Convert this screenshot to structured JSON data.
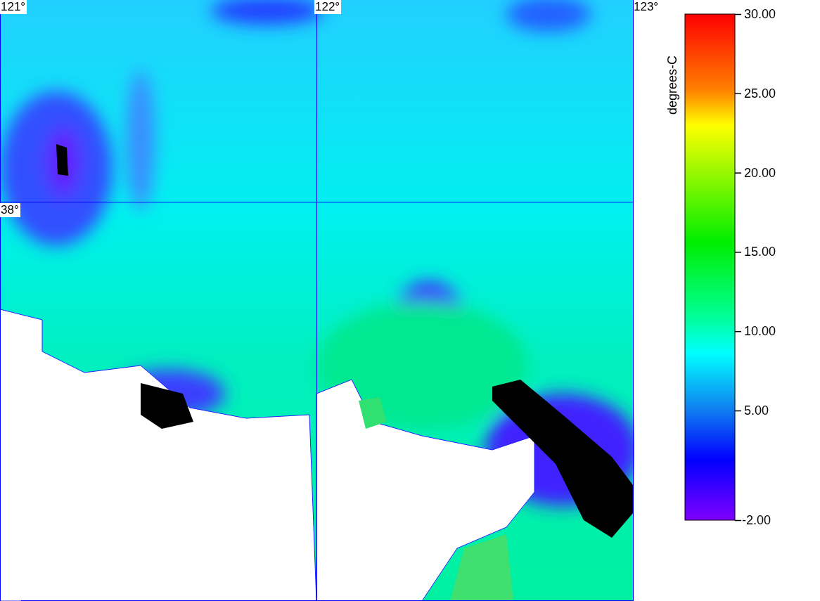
{
  "map": {
    "longitude_labels": [
      "121°",
      "122°",
      "123°"
    ],
    "latitude_labels": [
      "38°"
    ]
  },
  "colorbar": {
    "unit": "degrees-C",
    "tick_labels": [
      "30.00",
      "25.00",
      "20.00",
      "15.00",
      "10.00",
      "5.00",
      "-2.00"
    ]
  }
}
